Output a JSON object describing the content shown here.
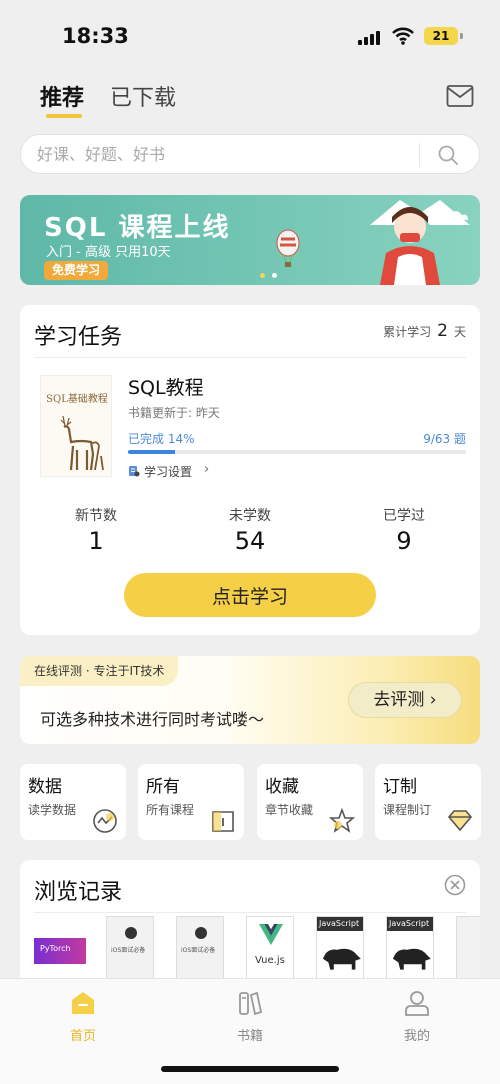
{
  "status_bar": {
    "time": "18:33",
    "battery": "21"
  },
  "header": {
    "tabs": [
      {
        "label": "推荐",
        "active": true
      },
      {
        "label": "已下载",
        "active": false
      }
    ]
  },
  "search": {
    "placeholder": "好课、好题、好书"
  },
  "banner": {
    "title": "SQL 课程上线",
    "subtitle": "入门 - 高级 只用10天",
    "button": "免费学习"
  },
  "task": {
    "title": "学习任务",
    "days_prefix": "累计学习",
    "days": "2",
    "days_suffix": "天",
    "book": {
      "cover_title": "SQL基础教程",
      "name": "SQL教程",
      "update": "书籍更新于: 昨天",
      "progress_label": "已完成 14%",
      "progress_percent": 14,
      "progress_count": "9/63 题",
      "settings": "学习设置"
    },
    "stats": [
      {
        "label": "新节数",
        "value": "1"
      },
      {
        "label": "未学数",
        "value": "54"
      },
      {
        "label": "已学过",
        "value": "9"
      }
    ],
    "button": "点击学习"
  },
  "evaluation": {
    "tag": "在线评测 · 专注于IT技术",
    "text": "可选多种技术进行同时考试喽～",
    "button": "去评测"
  },
  "shortcuts": [
    {
      "title": "数据",
      "sub": "读学数据",
      "icon": "chart-icon"
    },
    {
      "title": "所有",
      "sub": "所有课程",
      "icon": "book-icon"
    },
    {
      "title": "收藏",
      "sub": "章节收藏",
      "icon": "star-icon"
    },
    {
      "title": "订制",
      "sub": "课程制订",
      "icon": "diamond-icon"
    }
  ],
  "history": {
    "title": "浏览记录",
    "items": [
      {
        "label": "PyTorch"
      },
      {
        "label": "iOS面试必备"
      },
      {
        "label": "iOS面试必备"
      },
      {
        "label": "Vue.js"
      },
      {
        "label": "JavaScript"
      },
      {
        "label": "JavaScript"
      }
    ]
  },
  "tabbar": [
    {
      "label": "首页",
      "active": true
    },
    {
      "label": "书籍",
      "active": false
    },
    {
      "label": "我的",
      "active": false
    }
  ],
  "colors": {
    "accent": "#F5CF45",
    "progress": "#3D86E0",
    "banner": "#6CC0AE"
  }
}
